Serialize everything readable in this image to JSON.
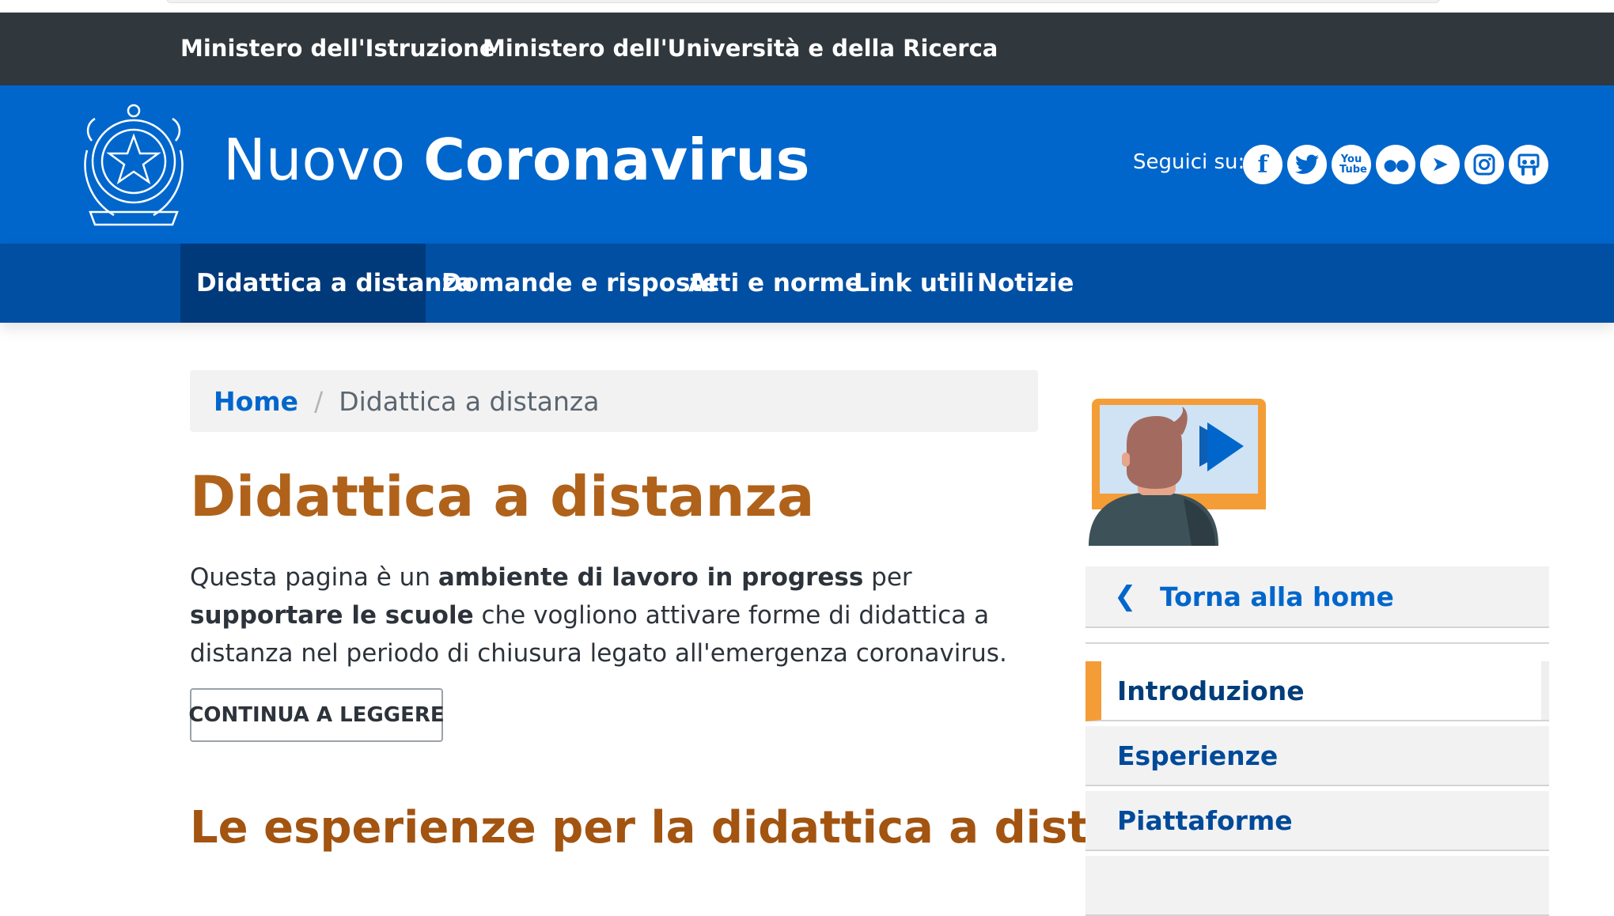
{
  "slim_header": {
    "links": [
      {
        "label": "Ministero dell'Istruzione"
      },
      {
        "label": "Ministero dell'Università e della Ricerca"
      }
    ]
  },
  "center_header": {
    "title_light": "Nuovo",
    "title_bold": "Coronavirus",
    "follow_label": "Seguici su:",
    "socials": [
      {
        "icon": "facebook-icon",
        "glyph": "f"
      },
      {
        "icon": "twitter-icon",
        "glyph": "t"
      },
      {
        "icon": "youtube-icon",
        "glyph": "You Tube"
      },
      {
        "icon": "flickr-icon",
        "glyph": "●●"
      },
      {
        "icon": "telegram-icon",
        "glyph": "➤"
      },
      {
        "icon": "instagram-icon",
        "glyph": "◘"
      },
      {
        "icon": "slideshare-icon",
        "glyph": "▣"
      }
    ]
  },
  "nav": {
    "items": [
      {
        "label": "Didattica a distanza",
        "active": true
      },
      {
        "label": "Domande e risposte"
      },
      {
        "label": "Atti e norme"
      },
      {
        "label": "Link utili"
      },
      {
        "label": "Notizie"
      }
    ]
  },
  "breadcrumb": {
    "home": "Home",
    "separator": "/",
    "current": "Didattica a distanza"
  },
  "main": {
    "title": "Didattica a distanza",
    "intro_parts": {
      "p1": "Questa pagina è un ",
      "b1": "ambiente di lavoro in progress",
      "p2": " per ",
      "b2": "supportare le scuole",
      "p3": " che vogliono attivare forme di didattica a distanza nel periodo di chiusura legato all'emergenza coronavirus."
    },
    "continue_label": "CONTINUA A LEGGERE",
    "section_title": "Le esperienze per la didattica a distanza"
  },
  "sidebar": {
    "back_label": "Torna alla home",
    "items": [
      {
        "label": "Introduzione",
        "active": true
      },
      {
        "label": "Esperienze"
      },
      {
        "label": "Piattaforme"
      }
    ]
  },
  "colors": {
    "slim_header_bg": "#30373d",
    "brand_blue": "#0066cc",
    "nav_blue": "#004fa3",
    "nav_active": "#003a7a",
    "title_orange": "#b0621a",
    "accent_orange": "#f49d37"
  }
}
